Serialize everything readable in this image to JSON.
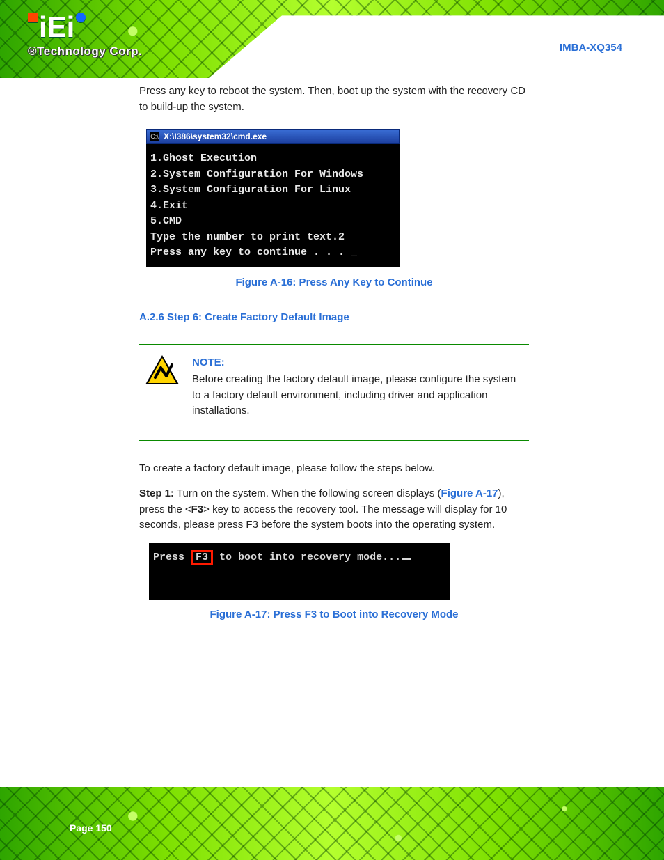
{
  "header": {
    "logo_text": "iEi",
    "tagline": "®Technology Corp.",
    "product": "IMBA-XQ354"
  },
  "intro_line": "Press any key to reboot the system. Then, boot up the system with the recovery CD",
  "cmd": {
    "title": "X:\\I386\\system32\\cmd.exe",
    "lines": [
      "1.Ghost Execution",
      "2.System Configuration For Windows",
      "3.System Configuration For Linux",
      "4.Exit",
      "5.CMD",
      "Type the number to print text.2",
      "Press any key to continue . . . _"
    ]
  },
  "fig1": {
    "label": "Figure A-16: Press Any Key to Continue"
  },
  "section": {
    "title": "A.2.6 Step 6: Create Factory Default Image"
  },
  "note": {
    "label": "NOTE:",
    "body": "Before creating the factory default image, please configure the system to a factory default environment, including driver and application installations."
  },
  "instr": {
    "prefix": "To create a factory default image, please follow the steps below.",
    "step_tag": "Step 1:",
    "step_body_a": "Turn on the system. When the following screen displays (",
    "fig_ref": "Figure A-17",
    "step_body_b": "), press the <",
    "key": "F3",
    "step_body_c": "> key to access the recovery tool. The message will display for 10 seconds, please press F3 before the system boots into the operating system."
  },
  "recov": {
    "pre": "Press ",
    "key": "F3",
    "post": " to boot into recovery mode..."
  },
  "fig2": {
    "label": "Figure A-17: Press F3 to Boot into Recovery Mode"
  },
  "page_number": "Page 150"
}
